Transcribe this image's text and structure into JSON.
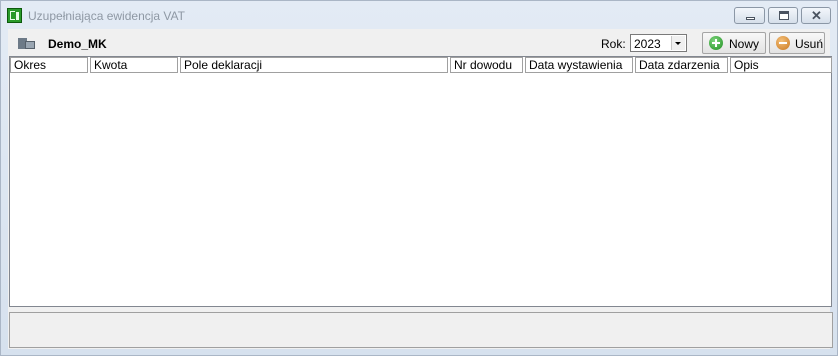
{
  "window": {
    "title": "Uzupełniająca ewidencja VAT"
  },
  "toolbar": {
    "company": "Demo_MK",
    "year_label": "Rok:",
    "year_value": "2023",
    "new_label": "Nowy",
    "delete_label": "Usuń"
  },
  "table": {
    "columns": [
      "Okres",
      "Kwota",
      "Pole deklaracji",
      "Nr dowodu",
      "Data wystawienia",
      "Data zdarzenia",
      "Opis"
    ],
    "rows": []
  },
  "colors": {
    "title_text": "#8e98a4",
    "add_icon": "#2a9a2a",
    "delete_icon": "#d98a2c"
  }
}
